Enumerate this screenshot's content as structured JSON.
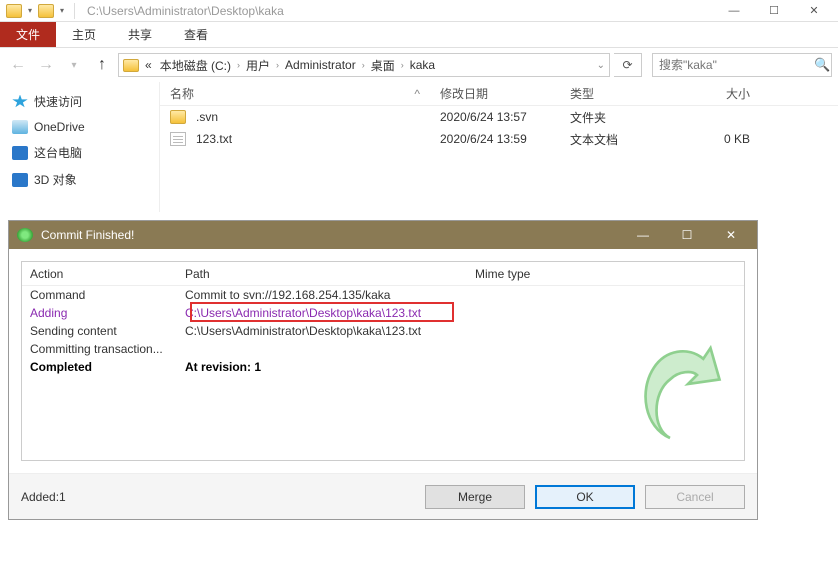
{
  "iconbar": {
    "path": "C:\\Users\\Administrator\\Desktop\\kaka"
  },
  "tabs": {
    "file": "文件",
    "home": "主页",
    "share": "共享",
    "view": "查看"
  },
  "breadcrumb": {
    "root": "«",
    "parts": [
      "本地磁盘 (C:)",
      "用户",
      "Administrator",
      "桌面",
      "kaka"
    ]
  },
  "search": {
    "placeholder": "搜索\"kaka\""
  },
  "sidebar": {
    "quick": "快速访问",
    "onedrive": "OneDrive",
    "thispc": "这台电脑",
    "threed": "3D 对象"
  },
  "fileheader": {
    "name": "名称",
    "date": "修改日期",
    "type": "类型",
    "size": "大小",
    "caret": "^"
  },
  "files": [
    {
      "name": ".svn",
      "date": "2020/6/24 13:57",
      "type": "文件夹",
      "size": "",
      "icon": "folder"
    },
    {
      "name": "123.txt",
      "date": "2020/6/24 13:59",
      "type": "文本文档",
      "size": "0 KB",
      "icon": "txt"
    }
  ],
  "dialog": {
    "title": "Commit Finished!",
    "header": {
      "action": "Action",
      "path": "Path",
      "mime": "Mime type"
    },
    "rows": [
      {
        "action": "Command",
        "path": "Commit to svn://192.168.254.135/kaka",
        "style": "black"
      },
      {
        "action": "Adding",
        "path": "C:\\Users\\Administrator\\Desktop\\kaka\\123.txt",
        "style": "purple"
      },
      {
        "action": "Sending content",
        "path": "C:\\Users\\Administrator\\Desktop\\kaka\\123.txt",
        "style": "black"
      },
      {
        "action": "Committing transaction...",
        "path": "",
        "style": "black"
      },
      {
        "action": "Completed",
        "path": "At revision: 1",
        "style": "bold"
      }
    ],
    "status": "Added:1",
    "buttons": {
      "merge": "Merge",
      "ok": "OK",
      "cancel": "Cancel"
    }
  }
}
